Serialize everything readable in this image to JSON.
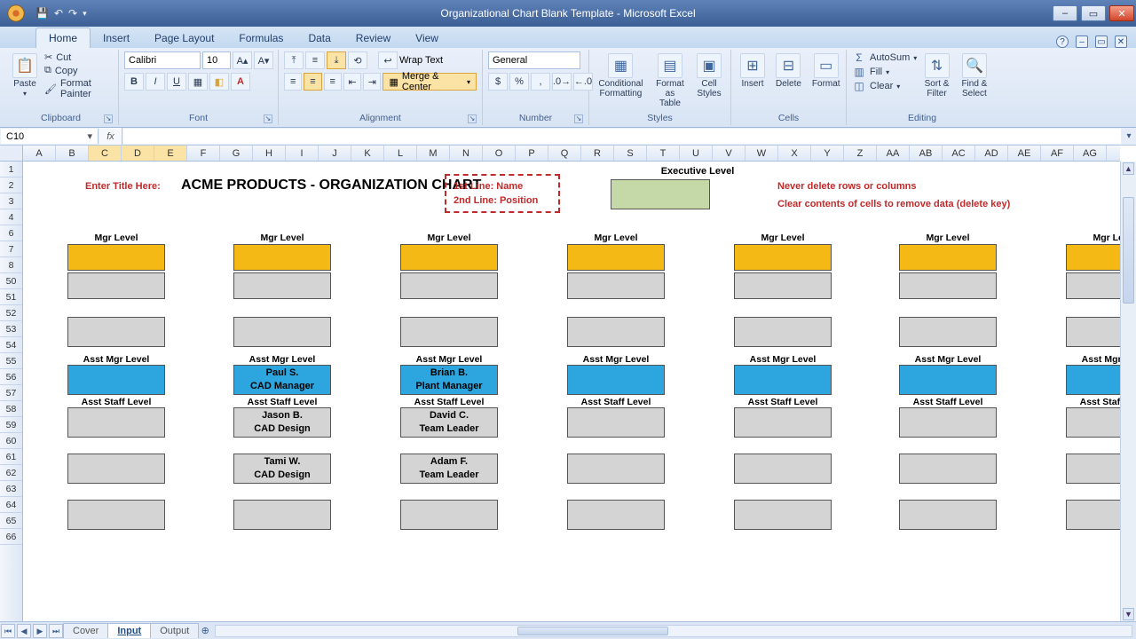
{
  "window": {
    "title": "Organizational Chart Blank Template - Microsoft Excel"
  },
  "tabs": {
    "home": "Home",
    "insert": "Insert",
    "page": "Page Layout",
    "formulas": "Formulas",
    "data": "Data",
    "review": "Review",
    "view": "View"
  },
  "ribbon": {
    "clipboard": {
      "paste": "Paste",
      "cut": "Cut",
      "copy": "Copy",
      "format_painter": "Format Painter",
      "label": "Clipboard"
    },
    "font": {
      "name": "Calibri",
      "size": "10",
      "label": "Font"
    },
    "alignment": {
      "wrap": "Wrap Text",
      "merge": "Merge & Center",
      "label": "Alignment"
    },
    "number": {
      "format": "General",
      "label": "Number"
    },
    "styles": {
      "cond": "Conditional Formatting",
      "table": "Format as Table",
      "cell": "Cell Styles",
      "label": "Styles"
    },
    "cells": {
      "insert": "Insert",
      "delete": "Delete",
      "format": "Format",
      "label": "Cells"
    },
    "editing": {
      "autosum": "AutoSum",
      "fill": "Fill",
      "clear": "Clear",
      "sort": "Sort & Filter",
      "find": "Find & Select",
      "label": "Editing"
    }
  },
  "namebox": "C10",
  "columns": [
    "A",
    "B",
    "C",
    "D",
    "E",
    "F",
    "G",
    "H",
    "I",
    "J",
    "K",
    "L",
    "M",
    "N",
    "O",
    "P",
    "Q",
    "R",
    "S",
    "T",
    "U",
    "V",
    "W",
    "X",
    "Y",
    "Z",
    "AA",
    "AB",
    "AC",
    "AD",
    "AE",
    "AF",
    "AG"
  ],
  "rows_top": [
    "1",
    "2",
    "3",
    "4",
    "6",
    "7",
    "8"
  ],
  "rows_bot": [
    "50",
    "51",
    "52",
    "53",
    "54",
    "55",
    "56",
    "57",
    "58",
    "59",
    "60",
    "61",
    "62",
    "63",
    "64",
    "65",
    "66"
  ],
  "sheet": {
    "enter_title": "Enter Title Here:",
    "title": "ACME PRODUCTS - ORGANIZATION CHART",
    "hint1": "1st Line: Name",
    "hint2": "2nd Line: Position",
    "exec_label": "Executive Level",
    "warn1": "Never delete rows or columns",
    "warn2": "Clear contents of cells to remove data (delete key)",
    "mgr_label": "Mgr Level",
    "asstmgr_label": "Asst Mgr Level",
    "asststaff_label": "Asst Staff Level",
    "cols": [
      {
        "asstmgr": {
          "name": "",
          "pos": ""
        },
        "staff1": {
          "name": "",
          "pos": ""
        },
        "staff2": {
          "name": "",
          "pos": ""
        }
      },
      {
        "asstmgr": {
          "name": "Paul S.",
          "pos": "CAD Manager"
        },
        "staff1": {
          "name": "Jason B.",
          "pos": "CAD Design"
        },
        "staff2": {
          "name": "Tami W.",
          "pos": "CAD Design"
        }
      },
      {
        "asstmgr": {
          "name": "Brian B.",
          "pos": "Plant Manager"
        },
        "staff1": {
          "name": "David C.",
          "pos": "Team Leader"
        },
        "staff2": {
          "name": "Adam F.",
          "pos": "Team Leader"
        }
      },
      {
        "asstmgr": {
          "name": "",
          "pos": ""
        },
        "staff1": {
          "name": "",
          "pos": ""
        },
        "staff2": {
          "name": "",
          "pos": ""
        }
      },
      {
        "asstmgr": {
          "name": "",
          "pos": ""
        },
        "staff1": {
          "name": "",
          "pos": ""
        },
        "staff2": {
          "name": "",
          "pos": ""
        }
      },
      {
        "asstmgr": {
          "name": "",
          "pos": ""
        },
        "staff1": {
          "name": "",
          "pos": ""
        },
        "staff2": {
          "name": "",
          "pos": ""
        }
      },
      {
        "asstmgr": {
          "name": "",
          "pos": ""
        },
        "staff1": {
          "name": "",
          "pos": ""
        },
        "staff2": {
          "name": "",
          "pos": ""
        }
      }
    ]
  },
  "sheetTabs": {
    "cover": "Cover",
    "input": "Input",
    "output": "Output"
  }
}
